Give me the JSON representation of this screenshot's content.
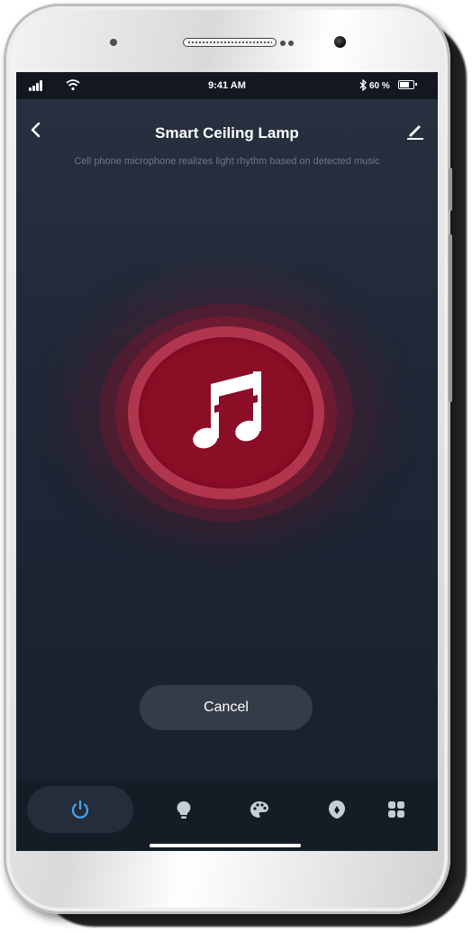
{
  "status_bar": {
    "time": "9:41 AM",
    "battery": "60 %"
  },
  "header": {
    "title": "Smart Ceiling Lamp",
    "subtitle": "Cell phone microphone realizes light rhythm based on detected music"
  },
  "actions": {
    "cancel_label": "Cancel"
  },
  "bottom_tabs": [
    {
      "icon": "power-icon",
      "active": true
    },
    {
      "icon": "bulb-icon",
      "active": false
    },
    {
      "icon": "palette-icon",
      "active": false
    },
    {
      "icon": "scene-icon",
      "active": false
    },
    {
      "icon": "grid-icon",
      "active": false
    }
  ],
  "colors": {
    "accent": "#8c0d26",
    "accent_light": "#b1354d",
    "active_tab_icon": "#4aa6f0",
    "inactive_tab_icon": "#c7cdd6",
    "screen_background": "#1e2736"
  }
}
